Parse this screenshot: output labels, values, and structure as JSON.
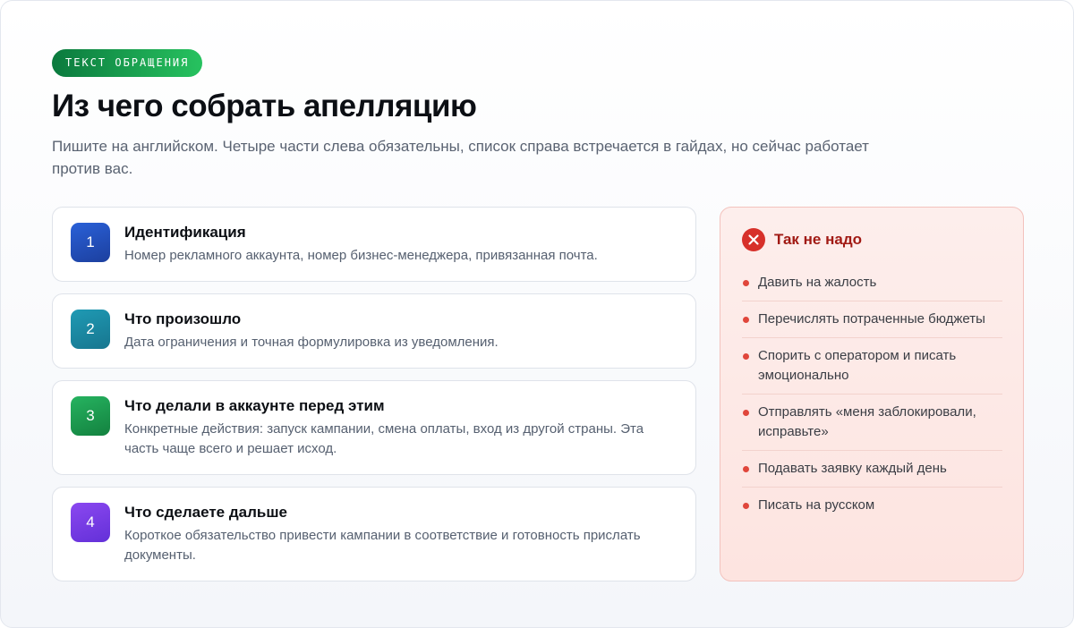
{
  "badge": "ТЕКСТ ОБРАЩЕНИЯ",
  "title": "Из чего собрать апелляцию",
  "subtitle": "Пишите на английском. Четыре части слева обязательны, список справа встречается в гайдах, но сейчас работает против вас.",
  "steps": [
    {
      "number": "1",
      "title": "Идентификация",
      "description": "Номер рекламного аккаунта, номер бизнес-менеджера, привязанная почта.",
      "color": "#2a55c8"
    },
    {
      "number": "2",
      "title": "Что произошло",
      "description": "Дата ограничения и точная формулировка из уведомления.",
      "color": "#1b8aa3"
    },
    {
      "number": "3",
      "title": "Что делали в аккаунте перед этим",
      "description": "Конкретные действия: запуск кампании, смена оплаты, вход из другой страны. Эта часть чаще всего и решает исход.",
      "color": "#1d9d50"
    },
    {
      "number": "4",
      "title": "Что сделаете дальше",
      "description": "Короткое обязательство привести кампании в соответствие и готовность прислать документы.",
      "color": "#7a3ce8"
    }
  ],
  "dont": {
    "icon": "close-circle-icon",
    "title": "Так не надо",
    "accent_color": "#d7302a",
    "items": [
      "Давить на жалость",
      "Перечислять потраченные бюджеты",
      "Спорить с оператором и писать эмоционально",
      "Отправлять «меня заблокировали, исправьте»",
      "Подавать заявку каждый день",
      "Писать на русском"
    ]
  }
}
